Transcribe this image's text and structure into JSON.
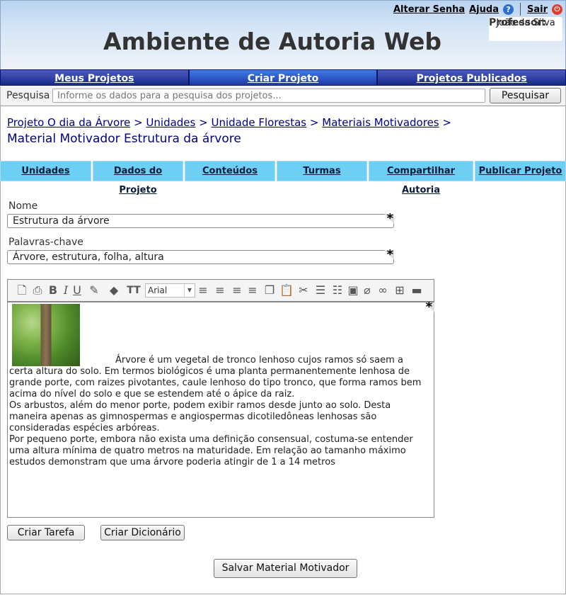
{
  "header": {
    "title": "Ambiente de Autoria Web",
    "links": {
      "change_password": "Alterar Senha",
      "help": "Ajuda",
      "exit": "Sair"
    },
    "user": {
      "role_label": "Professor:",
      "name": "João da Silva"
    }
  },
  "main_nav": [
    "Meus Projetos",
    "Criar Projeto",
    "Projetos Publicados"
  ],
  "search": {
    "label": "Pesquisa",
    "placeholder": "Informe os dados para a pesquisa dos projetos...",
    "button": "Pesquisar"
  },
  "breadcrumb": {
    "links": [
      "Projeto O dia da Árvore",
      "Unidades",
      "Unidade Florestas",
      "Materiais Motivadores"
    ],
    "separator": ">",
    "current": "Material Motivador Estrutura da árvore"
  },
  "tabs": [
    "Unidades",
    "Dados do Projeto",
    "Conteúdos",
    "Turmas",
    "Compartilhar Autoria",
    "Publicar Projeto"
  ],
  "form": {
    "name_label": "Nome",
    "name_value": "Estrutura da árvore",
    "keywords_label": "Palavras-chave",
    "keywords_value": "Árvore, estrutura, folha, altura",
    "required_mark": "*"
  },
  "editor": {
    "font": "Arial",
    "paragraphs": [
      "Árvore é um vegetal de tronco lenhoso cujos ramos só saem a certa altura do solo. Em termos biológicos é uma planta permanentemente lenhosa de grande porte, com raizes pivotantes, caule lenhoso do tipo tronco, que forma ramos bem acima do nível do solo e que se estendem até o ápice da raiz.",
      "Os arbustos, além do menor porte, podem exibir ramos desde junto ao solo. Desta maneira apenas as gimnospermas e angiospermas dicotiledôneas lenhosas são consideradas espécies arbóreas.",
      "Por pequeno porte, embora não exista uma definição consensual, costuma-se entender uma altura mínima de quatro metros na maturidade. Em relação ao tamanho máximo estudos demonstram que uma árvore poderia atingir de 1 a 14 metros"
    ]
  },
  "buttons": {
    "create_task": "Criar Tarefa",
    "create_dictionary": "Criar Dicionário",
    "save": "Salvar Material Motivador"
  }
}
